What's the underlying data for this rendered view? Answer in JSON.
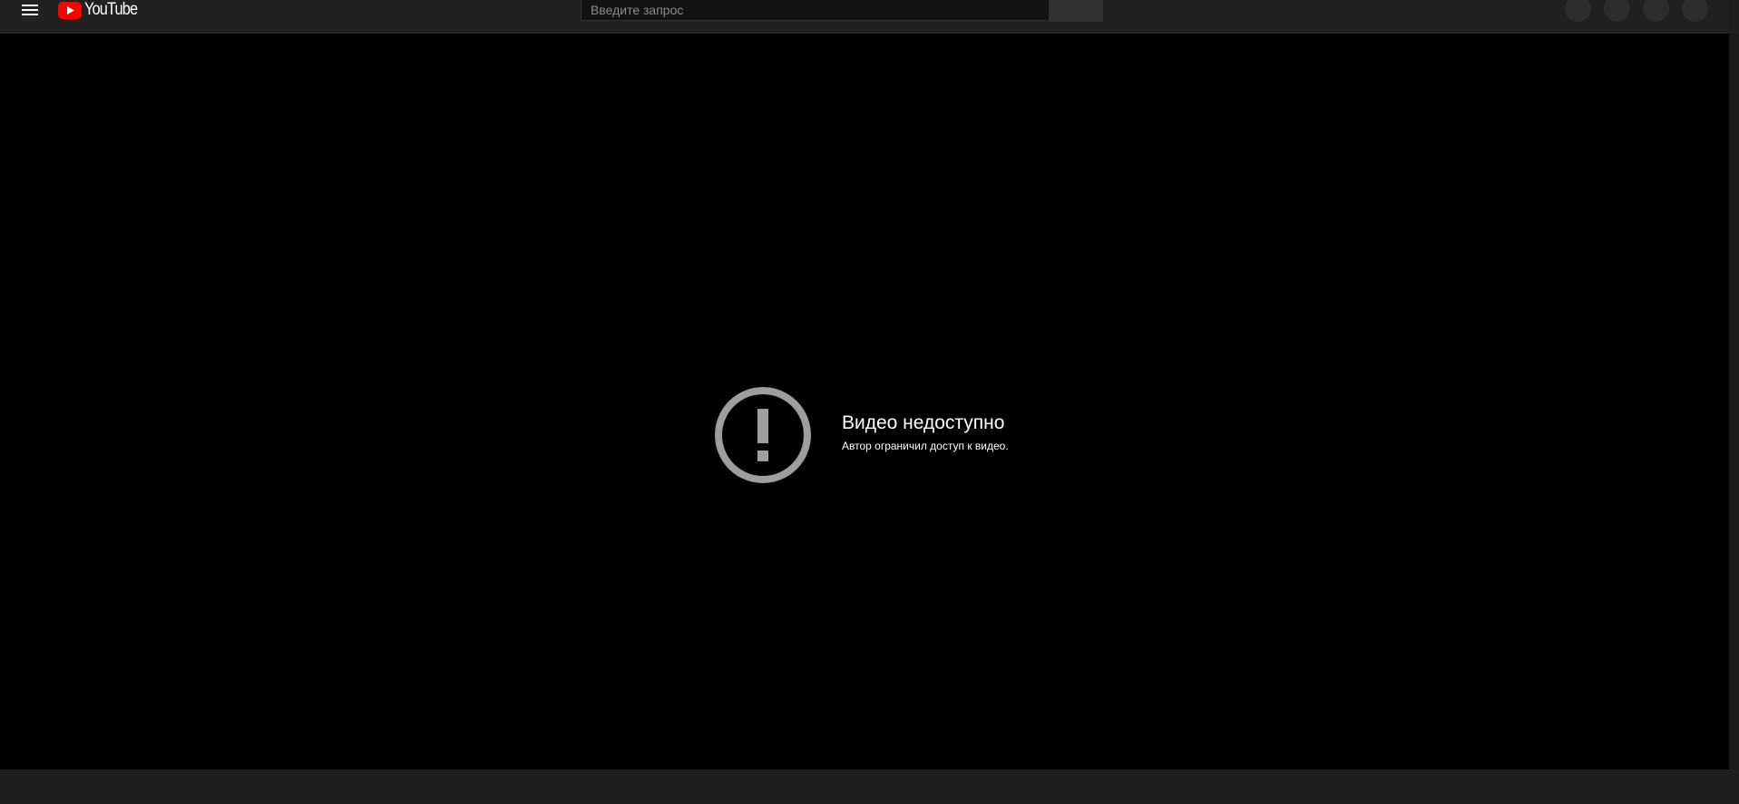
{
  "header": {
    "logo_text": "YouTube",
    "search_placeholder": "Введите запрос"
  },
  "icons": {
    "menu": "hamburger-menu-icon",
    "logo": "youtube-play-icon",
    "error": "exclamation-circle-icon"
  },
  "colors": {
    "brand_red": "#ff0000",
    "player_bg": "#000000",
    "header_bg": "#212121",
    "error_icon": "#9e9e9e"
  },
  "player": {
    "error_title": "Видео недоступно",
    "error_subtitle": "Автор ограничил доступ к видео."
  }
}
